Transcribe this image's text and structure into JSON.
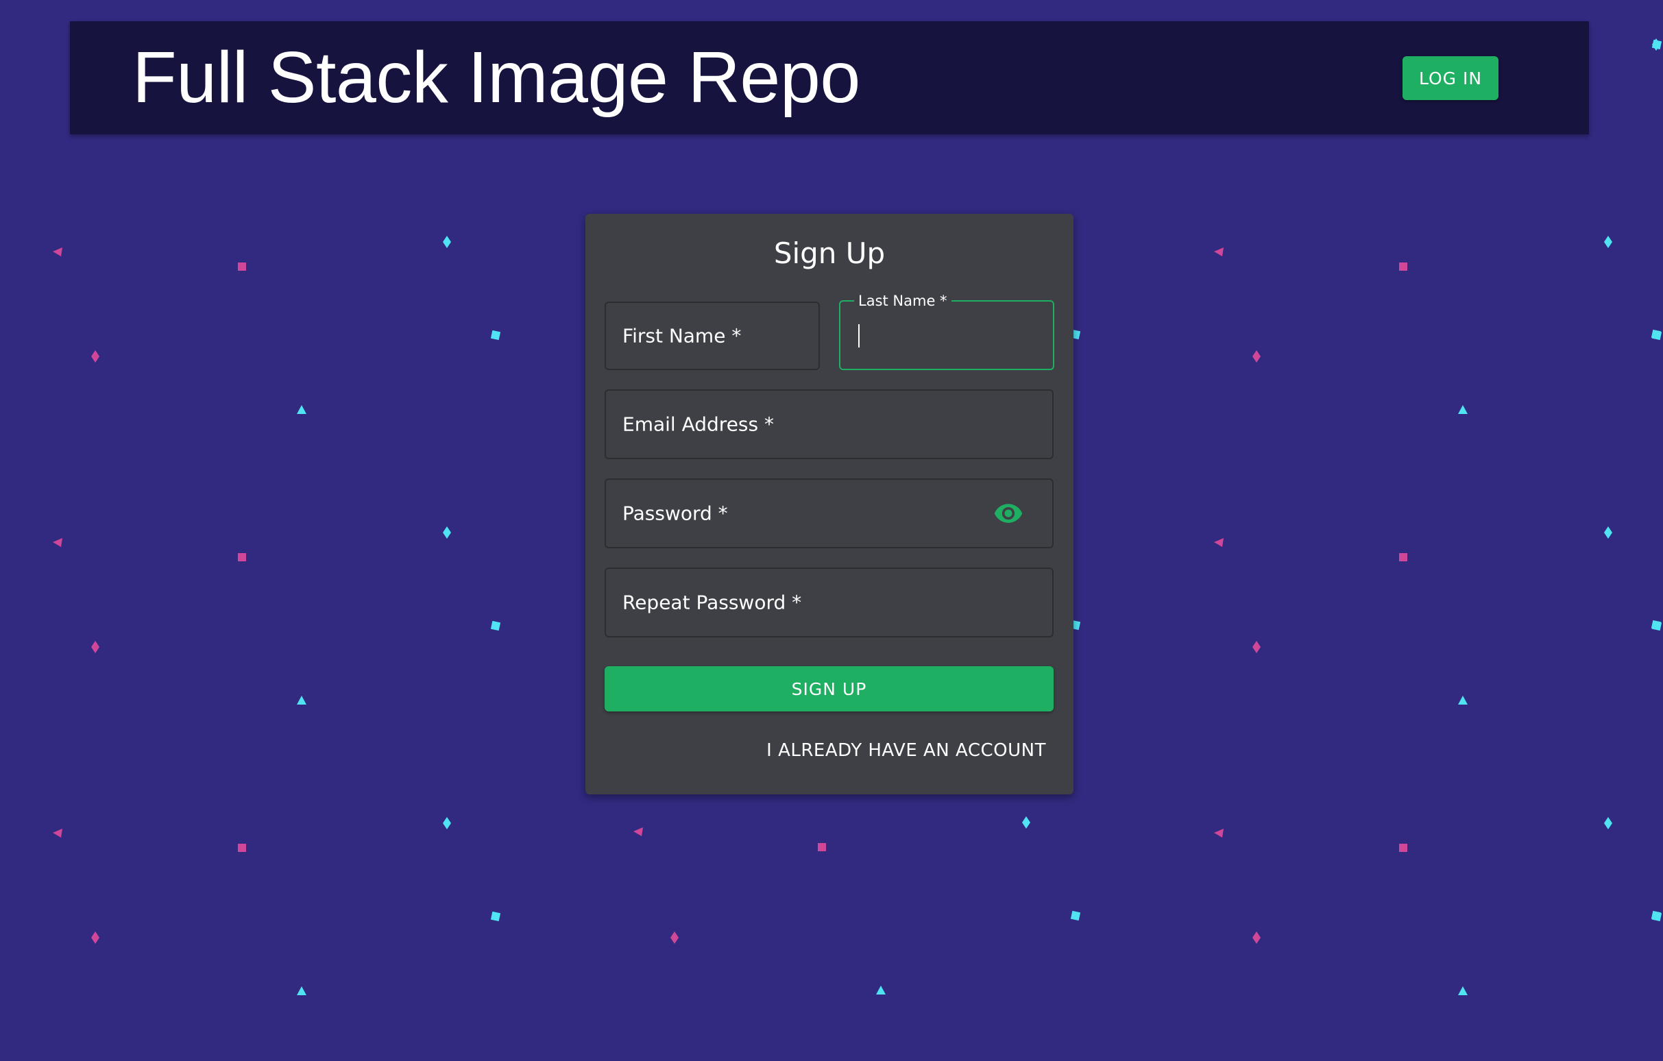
{
  "app_bar": {
    "title": "Full Stack Image Repo",
    "login_label": "LOG IN"
  },
  "form": {
    "title": "Sign Up",
    "fields": {
      "first_name": {
        "label": "First Name *",
        "value": ""
      },
      "last_name": {
        "label": "Last Name *",
        "value": "",
        "focused": true
      },
      "email": {
        "label": "Email Address *",
        "value": ""
      },
      "password": {
        "label": "Password *",
        "value": "",
        "toggle_icon": "eye-icon"
      },
      "repeat_password": {
        "label": "Repeat Password *",
        "value": ""
      }
    },
    "submit_label": "SIGN UP",
    "account_link": "I ALREADY HAVE AN ACCOUNT"
  },
  "colors": {
    "background": "#312a80",
    "app_bar": "#16133f",
    "card": "#3e4046",
    "accent": "#1faf63",
    "pattern_pink": "#d0479a",
    "pattern_cyan": "#50e3f2"
  }
}
